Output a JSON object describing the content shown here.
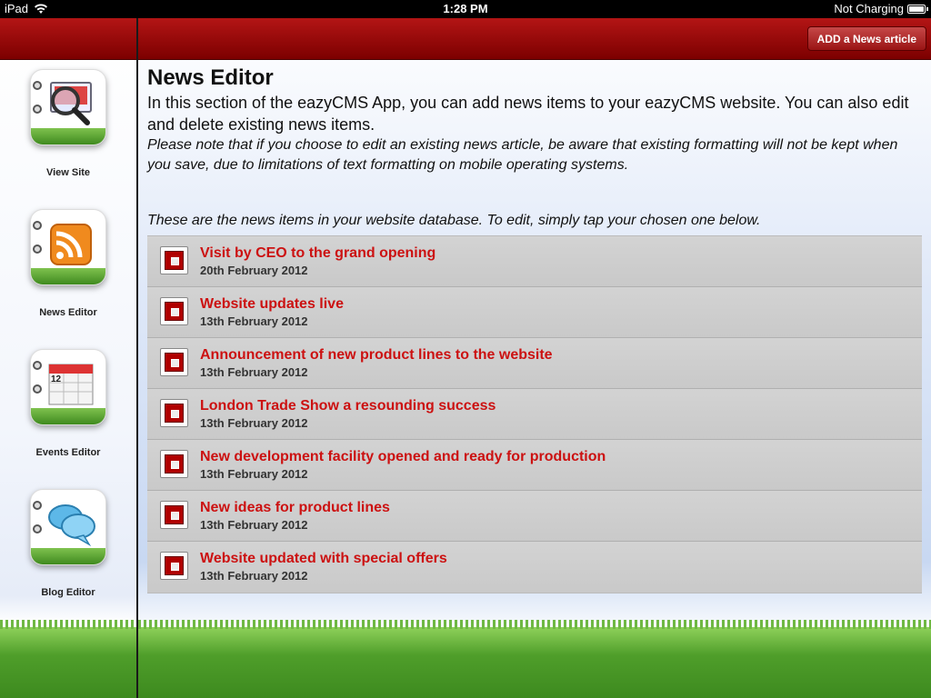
{
  "status_bar": {
    "device": "iPad",
    "time": "1:28 PM",
    "battery": "Not Charging"
  },
  "sidebar": {
    "items": [
      {
        "label": "View Site",
        "icon": "magnifier-computer-icon"
      },
      {
        "label": "News Editor",
        "icon": "rss-feed-icon"
      },
      {
        "label": "Events Editor",
        "icon": "calendar-icon",
        "icon_text": "12"
      },
      {
        "label": "Blog Editor",
        "icon": "speech-bubbles-icon"
      }
    ]
  },
  "header": {
    "add_button_label": "ADD a News article"
  },
  "main": {
    "title": "News Editor",
    "intro": "In this section of the eazyCMS App, you can add news items to your eazyCMS website. You can also edit and delete existing news items.",
    "note": "Please note that if you choose to edit an existing news article, be aware that existing formatting will not be kept when you save, due to limitations of text formatting on mobile operating systems.",
    "list_intro": "These are the news items in your website database. To edit, simply tap your chosen one below."
  },
  "news_items": [
    {
      "title": "Visit by CEO to the grand opening",
      "date": "20th February 2012"
    },
    {
      "title": "Website updates live",
      "date": "13th February 2012"
    },
    {
      "title": "Announcement of new product lines to the website",
      "date": "13th February 2012"
    },
    {
      "title": "London Trade Show a resounding success",
      "date": "13th February 2012"
    },
    {
      "title": "New development facility opened and ready for production",
      "date": "13th February 2012"
    },
    {
      "title": "New ideas for product lines",
      "date": "13th February 2012"
    },
    {
      "title": "Website updated with special offers",
      "date": "13th February 2012"
    }
  ],
  "colors": {
    "header_red": "#9a0000",
    "title_red": "#cc1111",
    "row_gray": "#cfcfcf"
  }
}
